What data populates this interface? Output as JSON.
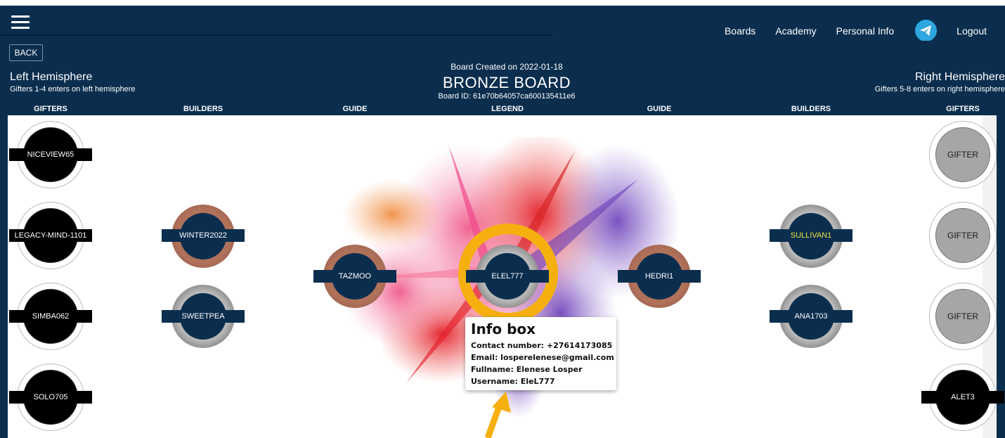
{
  "nav": {
    "links": [
      "Boards",
      "Academy",
      "Personal Info"
    ],
    "telegram_icon": "telegram-icon",
    "logout": "Logout",
    "background": "#0b2e4e"
  },
  "header": {
    "back_label": "BACK",
    "left_title": "Left Hemisphere",
    "left_sub": "Gifters 1-4 enters on left hemisphere",
    "right_title": "Right Hemisphere",
    "right_sub": "Gifters 5-8 enters on right hemisphere",
    "board_created": "Board Created on 2022-01-18",
    "board_title": "BRONZE BOARD",
    "board_id": "Board ID: 61e70b64057ca600135411e6"
  },
  "columns": [
    "GIFTERS",
    "BUILDERS",
    "GUIDE",
    "LEGEND",
    "GUIDE",
    "BUILDERS",
    "GIFTERS"
  ],
  "board": {
    "left_gifters": [
      "NICEVIEW65",
      "LEGACY-MIND-1101",
      "SIMBA062",
      "SOLO705"
    ],
    "left_builders": [
      "WINTER2022",
      "SWEETPEA"
    ],
    "left_guide": "TAZMOO",
    "legend": "ELEL777",
    "right_guide": "HEDRI1",
    "right_builders": [
      "SULLIVAN1",
      "ANA1703"
    ],
    "right_gifters": [
      "GIFTER",
      "GIFTER",
      "GIFTER",
      "ALET3"
    ]
  },
  "infobox": {
    "title": "Info box",
    "contact": "Contact number: +27614173085",
    "email": "Email: losperelenese@gmail.com",
    "fullname": "Fullname: Elenese Losper",
    "username": "Username: EleL777"
  },
  "colors": {
    "navy": "#0b2e4e",
    "highlight": "#f5b010",
    "bronze": "#a2654e",
    "silver": "#9a9a9a",
    "highlight_text": "#f0e040"
  }
}
